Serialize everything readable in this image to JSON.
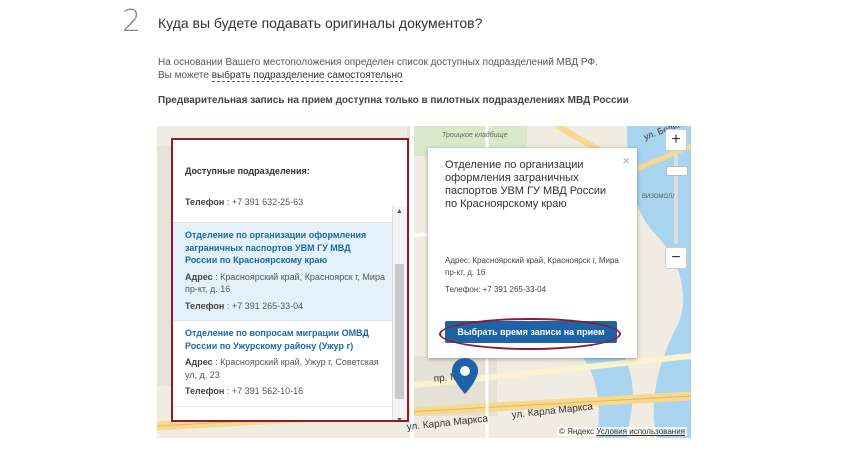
{
  "step": {
    "number": "2",
    "title": "Куда вы будете подавать оригиналы документов?",
    "info_line1": "На основании Вашего местоположения определен список доступных подразделений МВД РФ.",
    "info_line2_prefix": "Вы можете ",
    "info_link": "выбрать подразделение самостоятельно",
    "notice": "Предварительная запись на прием доступна только в пилотных подразделениях МВД России"
  },
  "list": {
    "header": "Доступные подразделения:",
    "partial_phone_label": "Телефон",
    "partial_phone_value": " : +7 391 632-25-63",
    "items": [
      {
        "name": "Отделение по организации оформления заграничных паспортов УВМ ГУ МВД России по Красноярскому краю",
        "address_label": "Адрес",
        "address": " : Красноярский край, Красноярск г, Мира пр-кт, д. 16",
        "phone_label": "Телефон",
        "phone": " : +7 391 265-33-04"
      },
      {
        "name": "Отделение по вопросам миграции ОМВД России по Ужурскому району (Ужур г)",
        "address_label": "Адрес",
        "address": " : Красноярский край, Ужур г, Советская ул, д. 23",
        "phone_label": "Телефон",
        "phone": " : +7 391 562-10-16"
      }
    ]
  },
  "popup": {
    "title": "Отделение по организации оформления заграничных паспортов УВМ ГУ МВД России по Красноярскому краю",
    "address": "Адрес: Красноярский край, Красноярск г, Мира пр-кт, д. 16",
    "phone": "Телефон: +7 391 265-33-04",
    "button": "Выбрать время записи на прием",
    "close": "×"
  },
  "map": {
    "zoom_in": "+",
    "zoom_out": "−",
    "attribution_prefix": "© Яндекс ",
    "attribution_link": "Условия использования",
    "labels": {
      "cemetery": "Троицкое кладбище",
      "street_karla_marksa": "ул. Карла Маркса",
      "street_mira": "пр. Мира",
      "street_belin": "ул. Белин",
      "market": "ВИЗОМОЛЛ"
    }
  },
  "colors": {
    "accent": "#1e63a8",
    "highlight": "#8b1d2c",
    "link": "#1a6aa6",
    "selected_bg": "#e4f1fa",
    "water": "#a9d4ef"
  }
}
